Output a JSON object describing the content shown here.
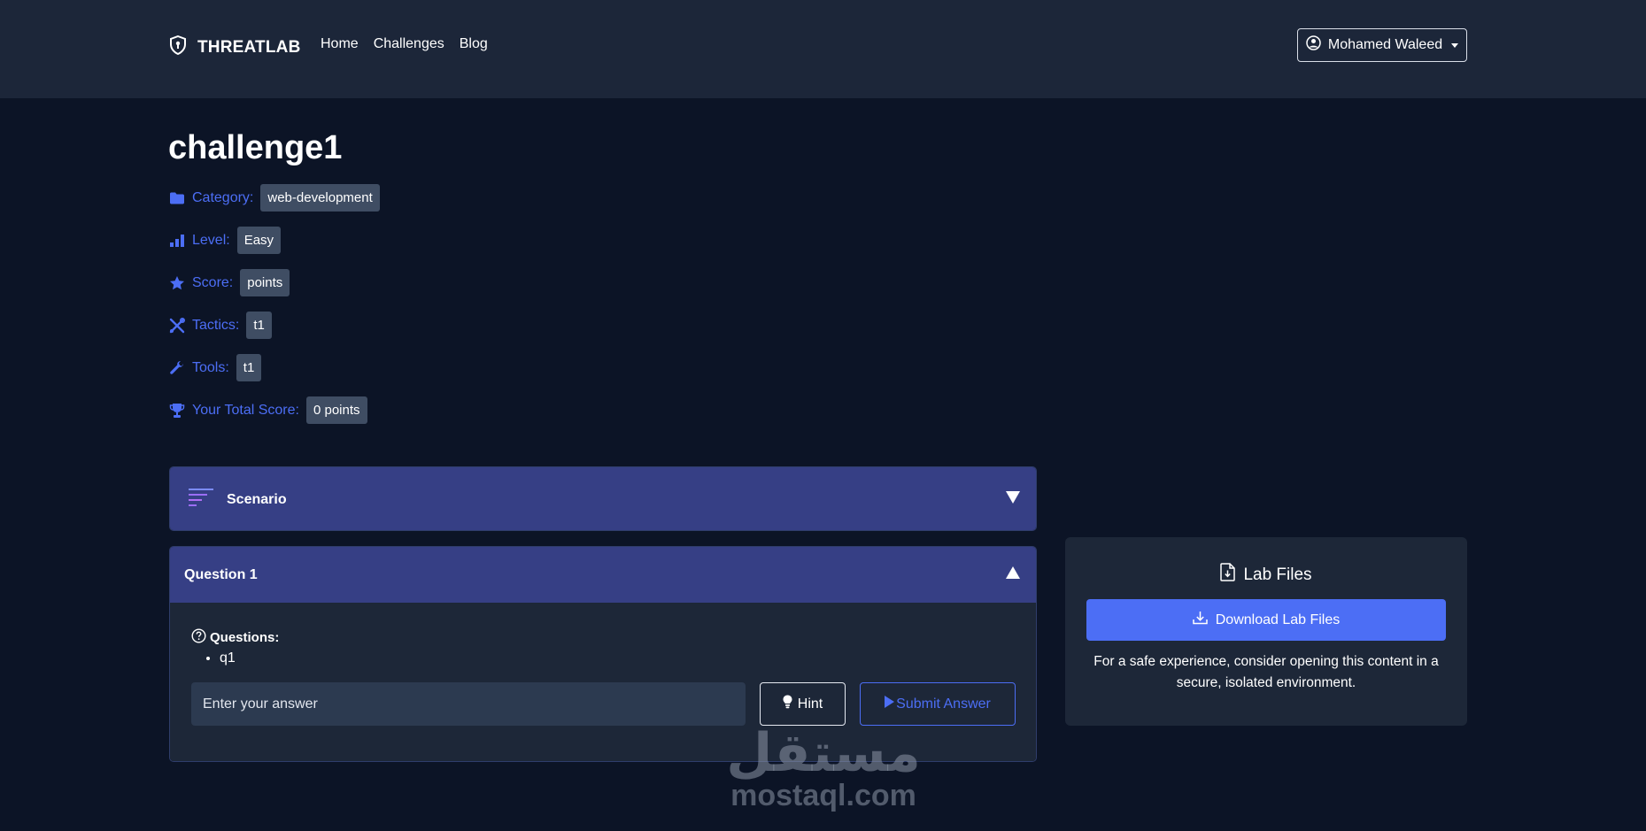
{
  "brand": {
    "name": "THREATLAB"
  },
  "nav": {
    "home": "Home",
    "challenges": "Challenges",
    "blog": "Blog"
  },
  "user": {
    "name": "Mohamed Waleed"
  },
  "challenge": {
    "title": "challenge1",
    "meta": [
      {
        "label": "Category:",
        "value": "web-development",
        "icon": "folder-icon"
      },
      {
        "label": "Level:",
        "value": "Easy",
        "icon": "bar-chart-icon"
      },
      {
        "label": "Score:",
        "value": "points",
        "icon": "star-icon"
      },
      {
        "label": "Tactics:",
        "value": "t1",
        "icon": "tools-icon"
      },
      {
        "label": "Tools:",
        "value": "t1",
        "icon": "wrench-icon"
      },
      {
        "label": "Your Total Score:",
        "value": "0 points",
        "icon": "trophy-icon"
      }
    ]
  },
  "scenario": {
    "title": "Scenario"
  },
  "question": {
    "title": "Question 1",
    "label": "Questions:",
    "items": [
      "q1"
    ],
    "answer_placeholder": "Enter your answer",
    "hint_label": "Hint",
    "submit_label": "Submit Answer"
  },
  "lab": {
    "title": "Lab Files",
    "download_label": "Download Lab Files",
    "note": "For a safe experience, consider opening this content in a secure, isolated environment."
  },
  "watermark": {
    "arabic": "مستقل",
    "latin": "mostaql.com"
  },
  "colors": {
    "accent": "#4c6ef5",
    "header_bg": "#1c2639",
    "page_bg": "#0c1426",
    "accordion_bg": "#363f85"
  }
}
